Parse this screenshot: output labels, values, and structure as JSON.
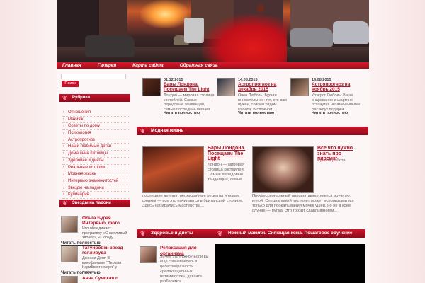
{
  "nav": [
    "Главная",
    "Галерея",
    "Карта сайта",
    "Обратная связь"
  ],
  "search": {
    "placeholder": "",
    "button": "Поиск"
  },
  "sidebar": {
    "rubrics_title": "Рубрики",
    "rubrics": [
      "Отношения",
      "Макияж",
      "Советы по дому",
      "Психология",
      "Астропрогноз",
      "Наши любимые детки",
      "Домашние питомцы",
      "Здоровье и диеты",
      "Реальные истории",
      "Модная жизнь",
      "Интервью знаменитостей",
      "Звезды на ладони",
      "Кулинария"
    ],
    "stars_title": "Звезды на ладони",
    "stars": [
      {
        "title": "Ольга Бурая. Интервью, фото",
        "text": "Что объединяет программу «Счастливый звонок», «Погоду...",
        "more": "Читать полностью"
      },
      {
        "title": "Татуировки звезд голливуда",
        "text": "Джонни Депп В кинофильме \"Пираты Карибского моря\" у героя...",
        "more": "Читать полностью"
      },
      {
        "title": "Анна Сумская о",
        "text": "",
        "more": ""
      }
    ]
  },
  "featured": [
    {
      "date": "01.12.2015",
      "title": "Бары Лондона. Посещаем The Light",
      "text": "Лондон — мировая столица коктейлей. Самые передовые тенденции, самые последние веяния...",
      "more": "Читать полностью"
    },
    {
      "date": "14.08.2015",
      "title": "Астропрогноз на декабрь 2015",
      "text": "Овен Любовь: Будьте внимательнее: тот, кто вам нужен, совсем рядом. Работа: В сложной...",
      "more": "Читать полностью"
    },
    {
      "date": "14.08.2015",
      "title": "Астропрогноз на ноябрь 2015",
      "text": "Козерог Любовь: Ваше очарование и шарм не останутся незамеченными. Вас ждут подарки...",
      "more": "Читать полностью"
    }
  ],
  "sections": {
    "fashion": "Модная жизнь",
    "health": "Здоровье и диеты",
    "makeup": "Нежный макияж. Сияющая кожа. Пошаговое обучение"
  },
  "fashion_articles": [
    {
      "title": "Бары Лондона. Посещаем The Light",
      "text_side": "Лондон — мировая столица коктейлей. Самые передовые тенденции, самые",
      "text_bottom": "последние веяния, неожиданные рецепты и новые формы — все это начинается в британской столице. Здесь набирались мастерства..."
    },
    {
      "title": "Все что нужно знать про пирсинг",
      "text_side": "Ручная работа",
      "text_bottom": "Профессиональный пирсинг выполняется вручную, иглой. Специальный пистолет может использоваться только для прокалывания мочек ушей, но не в коем случае — пулка. Это грозит сдавливанием..."
    }
  ],
  "health_article": {
    "title": "Релаксация для организма",
    "text": "Зачем это нужно? Если вы еще сомневаетесь в целесообразности «релаксационных пятиминуток», давайте разберемся..."
  }
}
